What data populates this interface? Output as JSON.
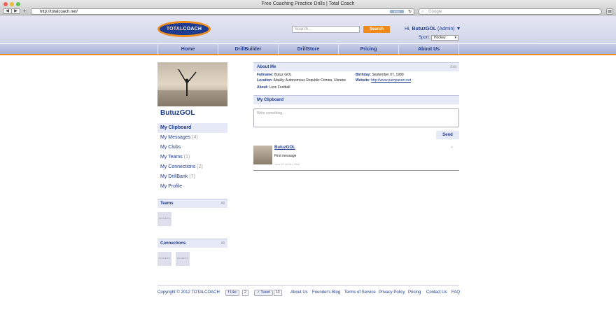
{
  "browser": {
    "title": "Free Coaching Practice Drills | Total Coach",
    "url": "http://totalcoach.net/",
    "rss_label": "RSS",
    "reload_icon": "reload-icon",
    "search_placeholder": "Google",
    "back_label": "◀",
    "forward_label": "▶",
    "add_label": "+"
  },
  "header": {
    "logo_text_1": "TOTAL",
    "logo_text_2": "COACH",
    "search_placeholder": "Search...",
    "search_button": "Search",
    "greeting_prefix": "Hi, ",
    "user_name": "ButuzGOL",
    "admin_suffix": " (Admin) ▼",
    "sport_label": "Sport:",
    "sport_value": "Hockey"
  },
  "menu": [
    "Home",
    "DrillBuilder",
    "DrillStore",
    "Pricing",
    "About Us"
  ],
  "profile": {
    "name": "ButuzGOL"
  },
  "sidebar": [
    {
      "label": "My Clipboard",
      "count": ""
    },
    {
      "label": "My Messages",
      "count": "(4)"
    },
    {
      "label": "My Clubs",
      "count": ""
    },
    {
      "label": "My Teams",
      "count": "(1)"
    },
    {
      "label": "My Connections",
      "count": "(2)"
    },
    {
      "label": "My DrillBank",
      "count": "(7)"
    },
    {
      "label": "My Profile",
      "count": ""
    }
  ],
  "teams": {
    "title": "Teams",
    "all": "All",
    "nophoto": "NO PHOTO"
  },
  "connections": {
    "title": "Connections",
    "all": "All",
    "nophoto": "NO PHOTO"
  },
  "about": {
    "title": "About Me",
    "edit": "Edit",
    "fullname_label": "Fullname:",
    "fullname": "Butuz GOL",
    "birthday_label": "Birthday:",
    "birthday": "September 07, 1989",
    "location_label": "Location:",
    "location": "Abakly, Autonomous Republic Crimea, Ukraine",
    "website_label": "Website:",
    "website": "http://www.parnparam.net",
    "about_label": "About:",
    "about_text": "Love Football"
  },
  "clipboard": {
    "title": "My Clipboard",
    "placeholder": "Write something...",
    "send": "Send"
  },
  "post": {
    "author": "ButuzGOL",
    "message": "First message",
    "time": "June 07 at 04:17AM",
    "close": "×"
  },
  "footer": {
    "copyright": "Copyright © 2012 TOTALCOACH",
    "like": "Like",
    "like_count": "2",
    "tweet": "Tweet",
    "tweet_count": "13",
    "links": [
      "About Us",
      "Founder's Blog",
      "Terms of Service",
      "Privacy Policy",
      "Pricing",
      "Contact Us",
      "FAQ"
    ]
  }
}
